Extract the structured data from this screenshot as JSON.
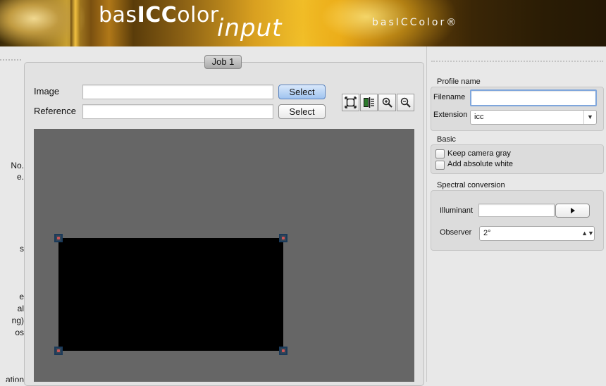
{
  "banner": {
    "title_prefix": "bas",
    "title_bold": "ICC",
    "title_suffix": "olor",
    "subtitle": "input",
    "brand_right": "basICColor®"
  },
  "left_panel": {
    "clipped_lines": [
      "No.",
      "e.",
      "s",
      "e",
      "al",
      "ng)",
      "os",
      "ation"
    ]
  },
  "job": {
    "tab_label": "Job 1",
    "image_label": "Image",
    "image_value": "",
    "image_select_label": "Select",
    "reference_label": "Reference",
    "reference_value": "",
    "reference_select_label": "Select",
    "tools": [
      {
        "icon": "fit-to-window-icon"
      },
      {
        "icon": "split-view-icon"
      },
      {
        "icon": "zoom-in-icon"
      },
      {
        "icon": "zoom-out-icon"
      }
    ]
  },
  "profile": {
    "section_title": "Profile name",
    "filename_label": "Filename",
    "filename_value": "",
    "extension_label": "Extension",
    "extension_value": "icc"
  },
  "basic": {
    "section_title": "Basic",
    "keep_gray_label": "Keep camera gray",
    "keep_gray_checked": false,
    "add_white_label": "Add absolute white",
    "add_white_checked": false
  },
  "spectral": {
    "section_title": "Spectral conversion",
    "illuminant_label": "Illuminant",
    "illuminant_value": "",
    "observer_label": "Observer",
    "observer_value": "2°"
  },
  "colors": {
    "accent": "#9fc3ef",
    "preview_bg": "#666666"
  }
}
